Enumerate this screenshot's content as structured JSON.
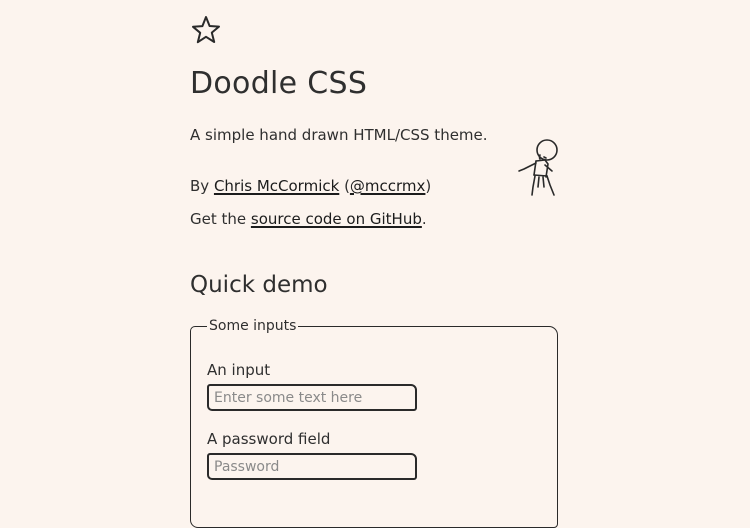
{
  "header": {
    "title": "Doodle CSS",
    "intro": "A simple hand drawn HTML/CSS theme.",
    "byline_prefix": "By ",
    "author_link": "Chris McCormick",
    "handle_open": " (",
    "handle_link": "@mccrmx",
    "handle_close": ")",
    "source_prefix": "Get the ",
    "source_link": "source code on GitHub",
    "source_suffix": "."
  },
  "demo": {
    "heading": "Quick demo",
    "fieldset_legend": "Some inputs",
    "input_label": "An input",
    "input_placeholder": "Enter some text here",
    "input_value": "",
    "password_label": "A password field",
    "password_placeholder": "Password",
    "password_value": ""
  },
  "icons": {
    "logo": "star-icon",
    "illustration": "stick-figure-doodle"
  },
  "colors": {
    "background": "#fcf4ee",
    "text": "#2f2f2f",
    "border": "#2a2a2a",
    "placeholder": "#8a8a8a"
  }
}
